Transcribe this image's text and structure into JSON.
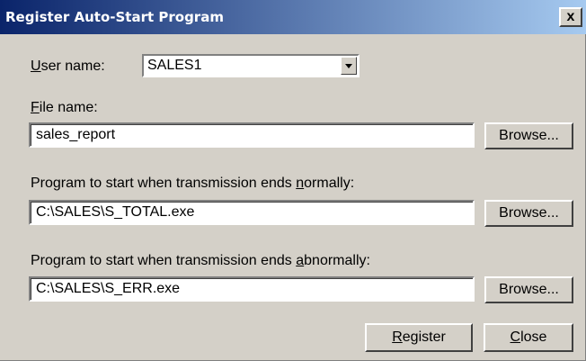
{
  "window": {
    "title": "Register Auto-Start Program",
    "close_label": "x"
  },
  "user": {
    "label_accel": "U",
    "label_rest": "ser name:",
    "value": "SALES1"
  },
  "file": {
    "label_accel": "F",
    "label_rest": "ile name:",
    "value": "sales_report",
    "browse_label": "Browse..."
  },
  "normal": {
    "label_pre": "Program to start when transmission ends ",
    "label_accel": "n",
    "label_post": "ormally:",
    "value": "C:\\SALES\\S_TOTAL.exe",
    "browse_label": "Browse..."
  },
  "abnormal": {
    "label_pre": "Program to start when transmission ends ",
    "label_accel": "a",
    "label_post": "bnormally:",
    "value": "C:\\SALES\\S_ERR.exe",
    "browse_label": "Browse..."
  },
  "buttons": {
    "register_accel": "R",
    "register_rest": "egister",
    "close_accel": "C",
    "close_rest": "lose"
  }
}
